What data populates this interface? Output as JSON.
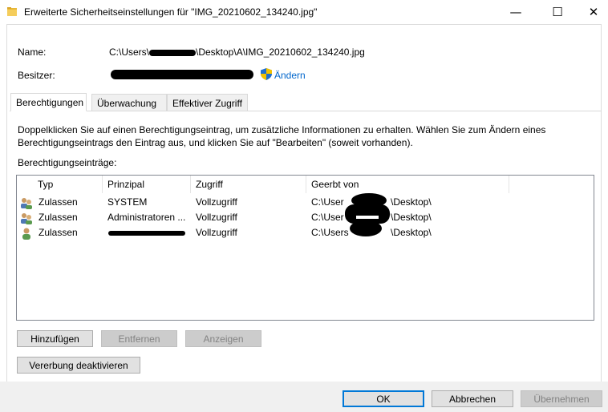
{
  "window": {
    "title": "Erweiterte Sicherheitseinstellungen für \"IMG_20210602_134240.jpg\"",
    "minimize": "—",
    "maximize": "☐",
    "close": "✕"
  },
  "info": {
    "name_label": "Name:",
    "name_value_prefix": "C:\\Users\\",
    "name_value_suffix": "\\Desktop\\A\\IMG_20210602_134240.jpg",
    "owner_label": "Besitzer:",
    "change_link": "Ändern"
  },
  "tabs": [
    {
      "label": "Berechtigungen"
    },
    {
      "label": "Überwachung"
    },
    {
      "label": "Effektiver Zugriff"
    }
  ],
  "description": "Doppelklicken Sie auf einen Berechtigungseintrag, um zusätzliche Informationen zu erhalten. Wählen Sie zum Ändern eines Berechtigungseintrags den Eintrag aus, und klicken Sie auf \"Bearbeiten\" (soweit vorhanden).",
  "entries_label": "Berechtigungseinträge:",
  "columns": [
    "Typ",
    "Prinzipal",
    "Zugriff",
    "Geerbt von"
  ],
  "rows": [
    {
      "type": "Zulassen",
      "principal": "SYSTEM",
      "access": "Vollzugriff",
      "inherited_prefix": "C:\\User",
      "inherited_suffix": "\\Desktop\\",
      "icon": "group-user-icon"
    },
    {
      "type": "Zulassen",
      "principal": "Administratoren ...",
      "access": "Vollzugriff",
      "inherited_prefix": "C:\\User",
      "inherited_suffix": "\\Desktop\\",
      "icon": "group-user-icon"
    },
    {
      "type": "Zulassen",
      "principal": "",
      "access": "Vollzugriff",
      "inherited_prefix": "C:\\Users",
      "inherited_suffix": "\\Desktop\\",
      "icon": "single-user-icon"
    }
  ],
  "buttons": {
    "add": "Hinzufügen",
    "remove": "Entfernen",
    "view": "Anzeigen",
    "disable_inheritance": "Vererbung deaktivieren",
    "ok": "OK",
    "cancel": "Abbrechen",
    "apply": "Übernehmen"
  },
  "colors": {
    "link": "#0066cc",
    "default_button_border": "#0078d7",
    "disabled_text": "#838383"
  }
}
